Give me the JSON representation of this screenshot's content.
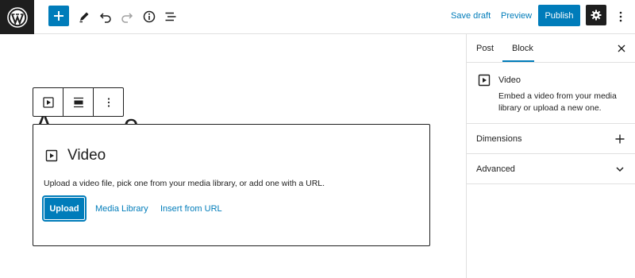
{
  "topbar": {
    "logo_icon": "wordpress-logo-icon",
    "icons": [
      "add-block-icon",
      "pencil-icon",
      "undo-icon",
      "redo-icon",
      "info-icon",
      "list-view-icon"
    ],
    "save_draft": "Save draft",
    "preview": "Preview",
    "publish": "Publish",
    "settings_icon": "gear-icon",
    "more_icon": "more-vertical-icon"
  },
  "canvas": {
    "title_peek_start": "A",
    "title_peek_end": "e"
  },
  "block_toolbar": {
    "items": [
      "video-block-icon",
      "align-icon",
      "more-options-icon"
    ]
  },
  "placeholder": {
    "title": "Video",
    "instructions": "Upload a video file, pick one from your media library, or add one with a URL.",
    "upload": "Upload",
    "media_library": "Media Library",
    "insert_url": "Insert from URL"
  },
  "sidebar": {
    "tabs": [
      "Post",
      "Block"
    ],
    "active_tab": "Block",
    "block_card": {
      "title": "Video",
      "description": "Embed a video from your media library or upload a new one."
    },
    "panels": [
      {
        "label": "Dimensions",
        "icon": "plus-icon"
      },
      {
        "label": "Advanced",
        "icon": "chevron-down-icon"
      }
    ]
  },
  "colors": {
    "accent": "#007cba",
    "dark": "#1e1e1e",
    "border": "#e0e0e0"
  }
}
